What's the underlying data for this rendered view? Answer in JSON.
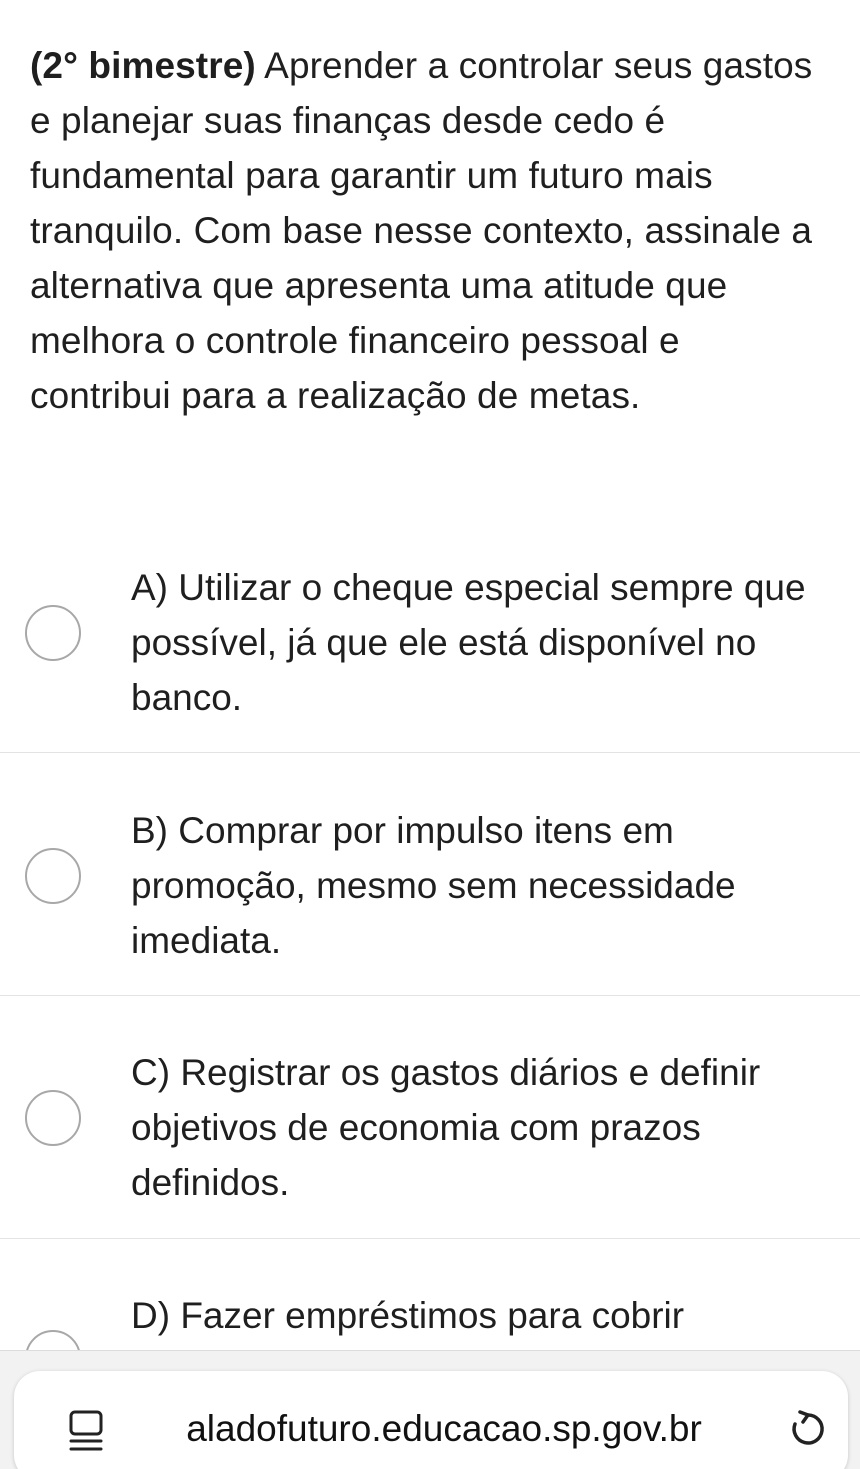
{
  "question": {
    "prefix": "(2° bimestre)",
    "text": " Aprender a controlar seus gastos e planejar suas finanças desde cedo é fundamental para garantir um futuro mais tranquilo. Com base nesse contexto, assinale a alternativa que apresenta uma atitude que melhora o controle financeiro pessoal e contribui para a realização de metas."
  },
  "options": [
    {
      "label": "A) Utilizar o cheque especial sempre que possível, já que ele está disponível no banco.",
      "selected": false
    },
    {
      "label": "B) Comprar por impulso itens em promoção, mesmo sem necessidade imediata.",
      "selected": false
    },
    {
      "label": "C) Registrar os gastos diários e definir objetivos de economia com prazos definidos.",
      "selected": false
    },
    {
      "label": "D) Fazer empréstimos para cobrir",
      "selected": false
    }
  ],
  "browser": {
    "url": "aladofuturo.educacao.sp.gov.br",
    "reader_icon": "reader-icon",
    "reload_icon": "reload-icon"
  }
}
